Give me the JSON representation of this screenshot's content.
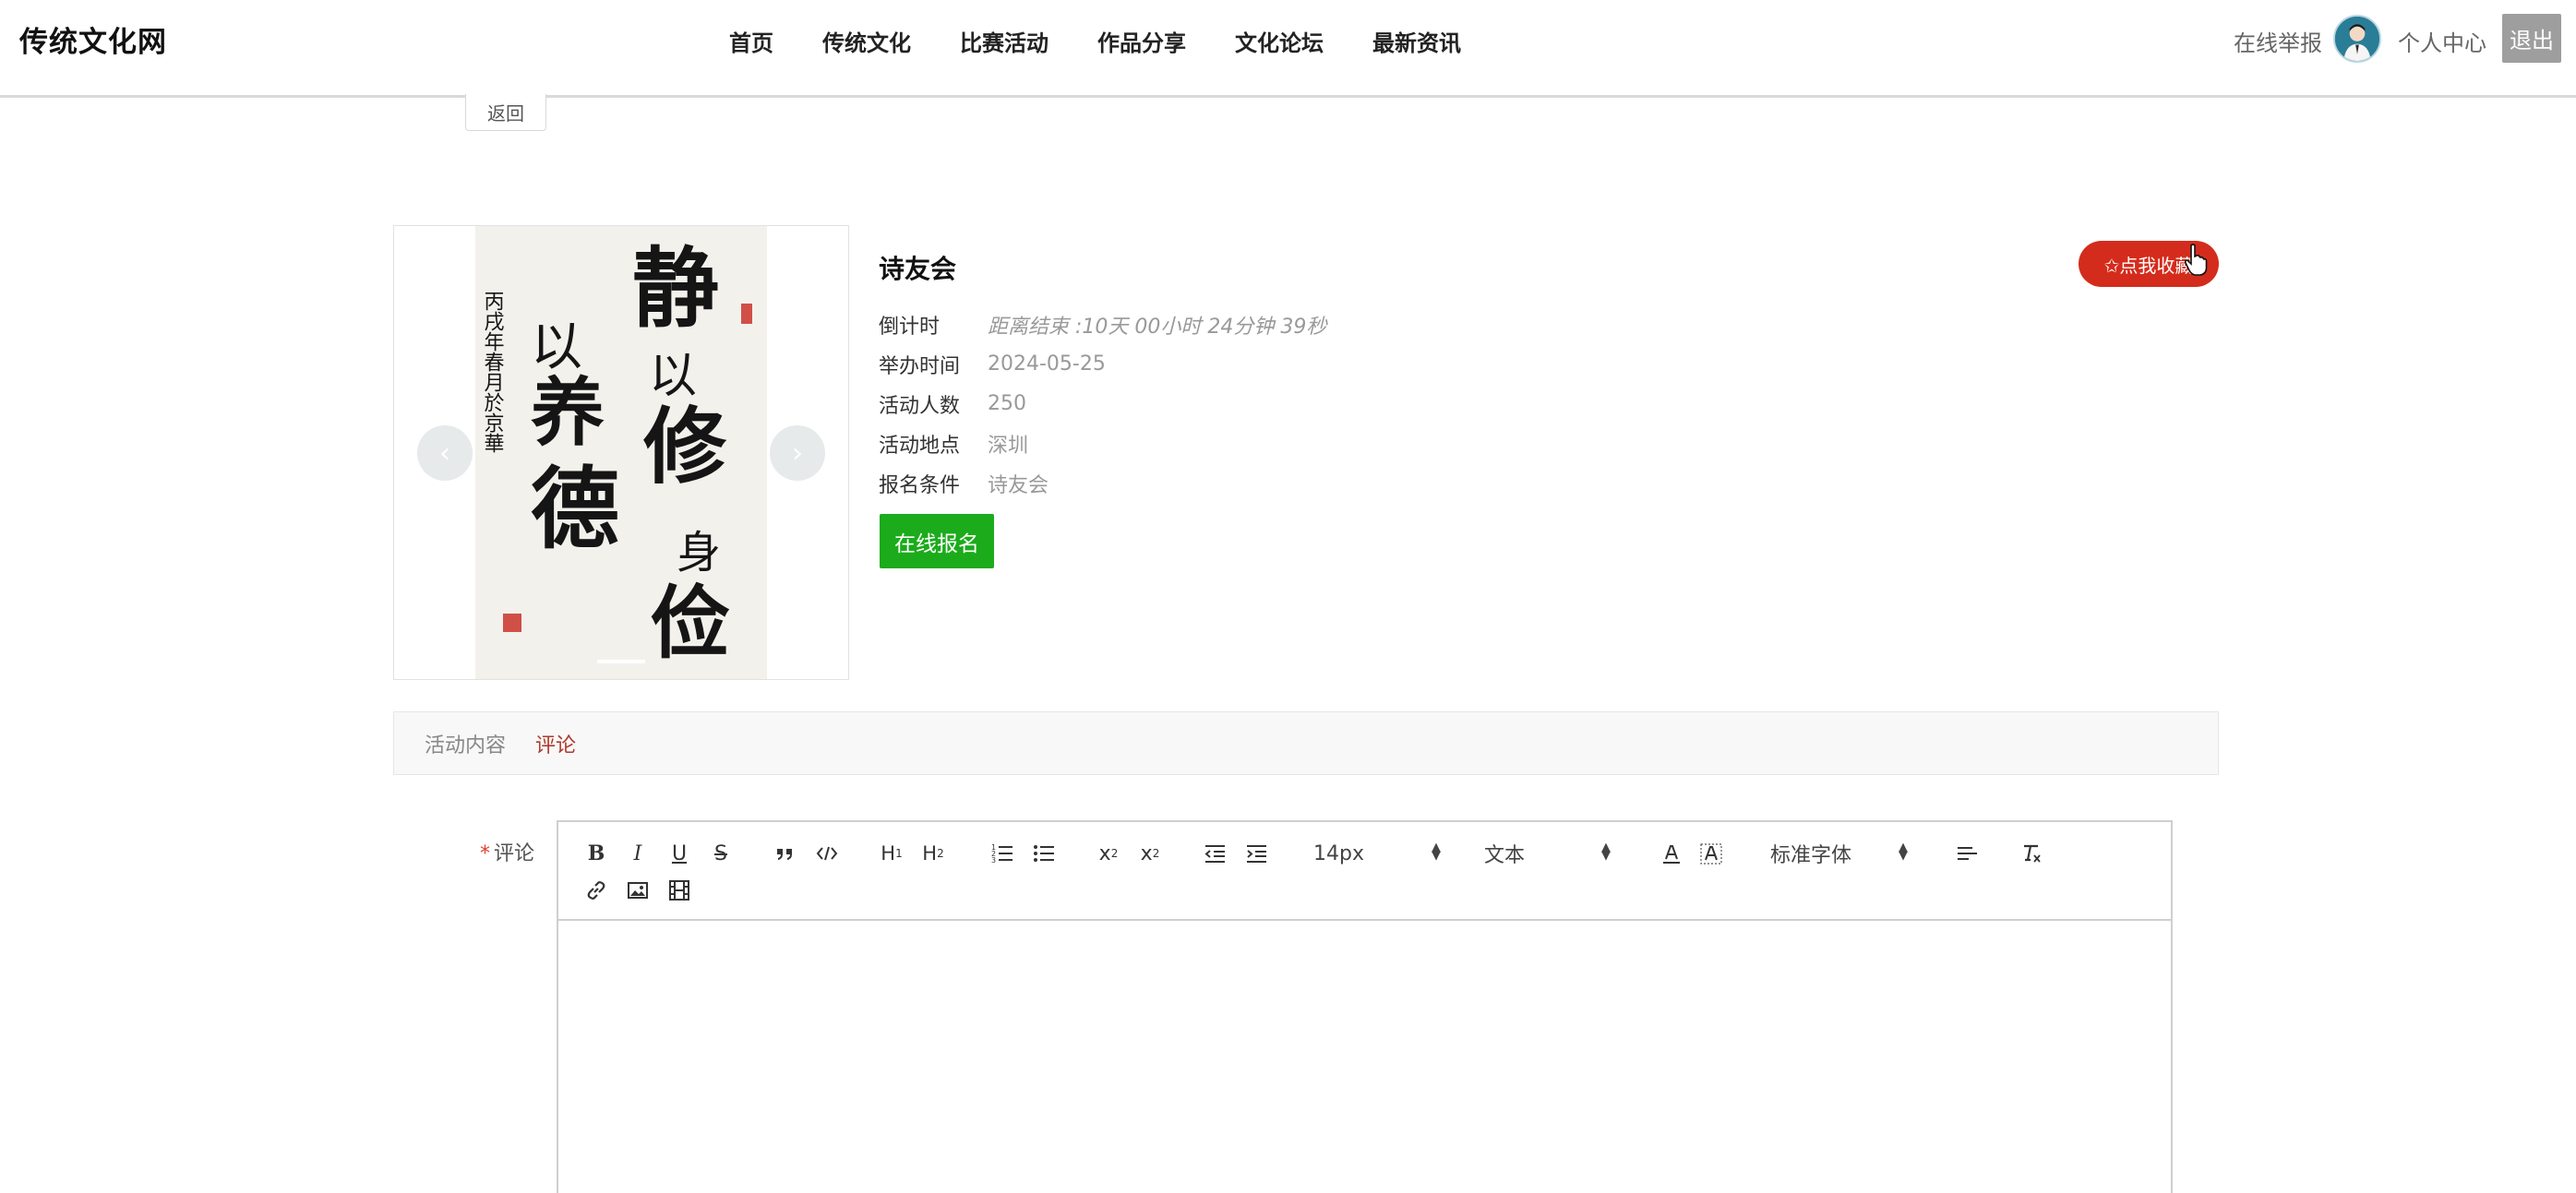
{
  "header": {
    "brand": "传统文化网",
    "nav": [
      "首页",
      "传统文化",
      "比赛活动",
      "作品分享",
      "文化论坛",
      "最新资讯"
    ],
    "report": "在线举报",
    "profile": "个人中心",
    "logout": "退出"
  },
  "back_label": "返回",
  "activity": {
    "title": "诗友会",
    "favorite_label": "✩点我收藏",
    "fields": [
      {
        "label": "倒计时",
        "value": "距离结束 :10天 00小时 24分钟 39秒"
      },
      {
        "label": "举办时间",
        "value": "2024-05-25"
      },
      {
        "label": "活动人数",
        "value": "250"
      },
      {
        "label": "活动地点",
        "value": "深圳"
      },
      {
        "label": "报名条件",
        "value": "诗友会"
      }
    ],
    "signup_label": "在线报名"
  },
  "carousel": {
    "prev": "‹",
    "next": "›",
    "slide_index": 1,
    "artwork_text": "静以修身 俭以养德"
  },
  "tabs": [
    {
      "label": "活动内容",
      "active": false
    },
    {
      "label": "评论",
      "active": true
    }
  ],
  "comment": {
    "required_mark": "*",
    "label": "评论",
    "toolbar": {
      "font_size": "14px",
      "heading": "文本",
      "font_family": "标准字体"
    }
  },
  "colors": {
    "brand_text": "#111111",
    "favorite": "#d42c1c",
    "signup": "#1bab1b",
    "active_tab": "#b03a2e",
    "logout": "#9e9e9e"
  }
}
